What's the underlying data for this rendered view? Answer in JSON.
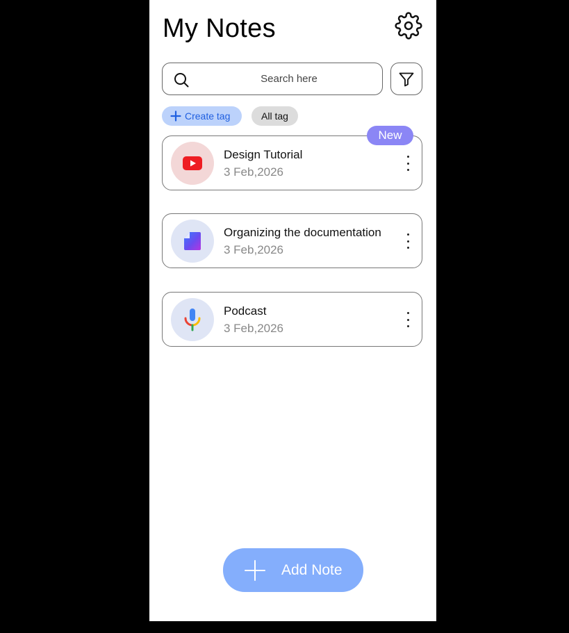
{
  "header": {
    "title": "My Notes",
    "settings_icon": "gear-icon"
  },
  "search": {
    "placeholder": "Search here",
    "value": "",
    "icon": "search-icon"
  },
  "filter": {
    "icon": "filter-icon"
  },
  "tags": {
    "create_label": "Create tag",
    "all_label": "All tag"
  },
  "notes": [
    {
      "title": "Design Tutorial",
      "date": "3 Feb,2026",
      "icon": "youtube-icon",
      "badge": "New"
    },
    {
      "title": "Organizing the documentation",
      "date": "3 Feb,2026",
      "icon": "document-icon"
    },
    {
      "title": "Podcast",
      "date": "3 Feb,2026",
      "icon": "microphone-icon"
    }
  ],
  "add_button": {
    "label": "Add Note",
    "icon": "plus-icon"
  },
  "colors": {
    "accent": "#84aefc",
    "badge": "#8b86f5",
    "create_tag_bg": "#bcd2fb",
    "create_tag_text": "#1f5fe0",
    "youtube_bg": "#f3d7d7",
    "doc_bg": "#dfe5f5",
    "mic_bg": "#dfe5f5"
  }
}
